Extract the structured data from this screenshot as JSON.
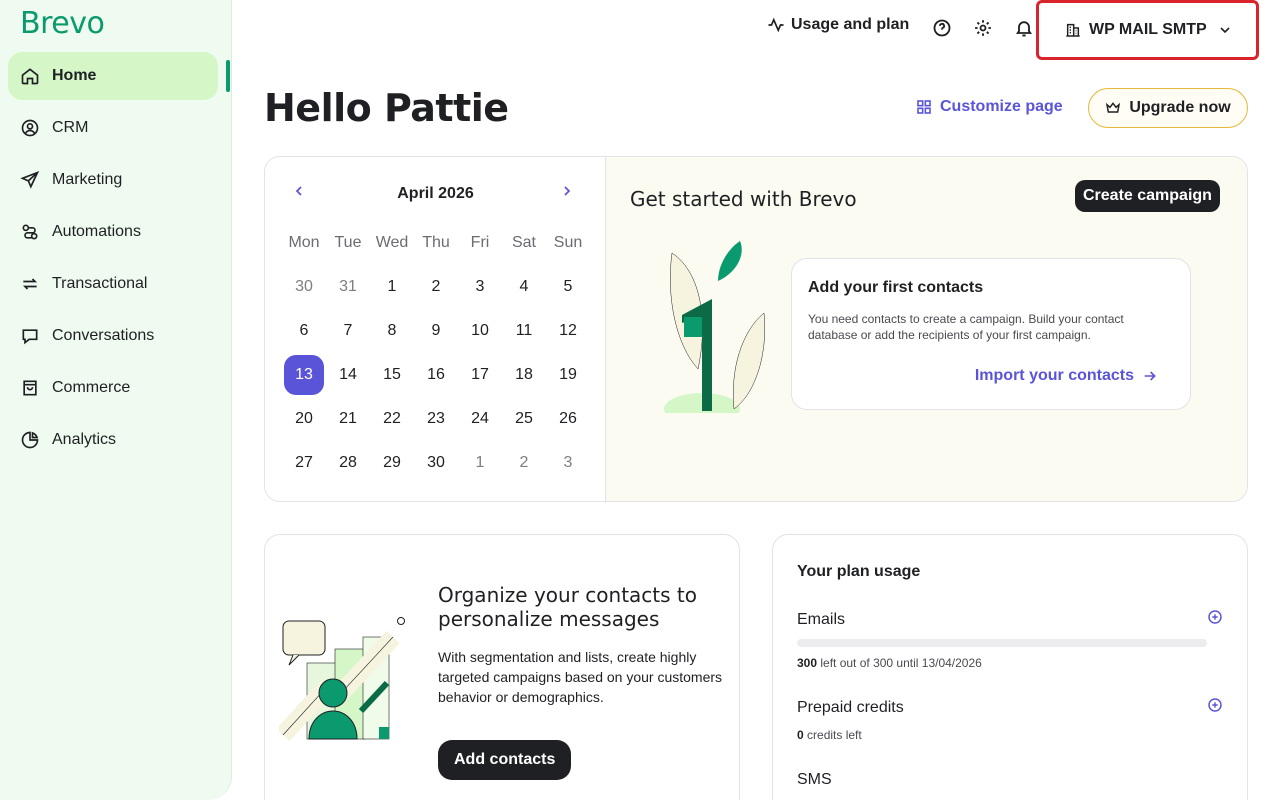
{
  "brand": {
    "logo": "Brevo"
  },
  "sidebar": {
    "items": [
      {
        "label": "Home",
        "icon": "home-icon",
        "active": true
      },
      {
        "label": "CRM",
        "icon": "user-circle-icon"
      },
      {
        "label": "Marketing",
        "icon": "paper-plane-icon"
      },
      {
        "label": "Automations",
        "icon": "automation-icon"
      },
      {
        "label": "Transactional",
        "icon": "arrows-exchange-icon"
      },
      {
        "label": "Conversations",
        "icon": "chat-bubble-icon"
      },
      {
        "label": "Commerce",
        "icon": "shopping-bag-icon"
      },
      {
        "label": "Analytics",
        "icon": "pie-chart-icon"
      }
    ]
  },
  "topbar": {
    "usage_label": "Usage and plan",
    "account_name": "WP MAIL SMTP"
  },
  "header": {
    "greeting": "Hello Pattie",
    "customize_label": "Customize page",
    "upgrade_label": "Upgrade now"
  },
  "calendar": {
    "month_label": "April 2026",
    "weekdays": [
      "Mon",
      "Tue",
      "Wed",
      "Thu",
      "Fri",
      "Sat",
      "Sun"
    ],
    "days": [
      [
        "30",
        "31",
        "1",
        "2",
        "3",
        "4",
        "5"
      ],
      [
        "6",
        "7",
        "8",
        "9",
        "10",
        "11",
        "12"
      ],
      [
        "13",
        "14",
        "15",
        "16",
        "17",
        "18",
        "19"
      ],
      [
        "20",
        "21",
        "22",
        "23",
        "24",
        "25",
        "26"
      ],
      [
        "27",
        "28",
        "29",
        "30",
        "1",
        "2",
        "3"
      ]
    ],
    "today": "13"
  },
  "get_started": {
    "title": "Get started with Brevo",
    "create_label": "Create campaign",
    "card_title": "Add your first contacts",
    "card_text": "You need contacts to create a campaign. Build your contact database or add the recipients of your first campaign.",
    "card_link": "Import your contacts"
  },
  "organize": {
    "title": "Organize your contacts to personalize messages",
    "text": "With segmentation and lists, create highly targeted campaigns based on your customers behavior or demographics.",
    "button_label": "Add contacts"
  },
  "plan": {
    "title": "Your plan usage",
    "emails_label": "Emails",
    "emails_left": "300",
    "emails_note": " left out of 300 until 13/04/2026",
    "emails_used_fraction": 0,
    "credits_label": "Prepaid credits",
    "credits_left": "0",
    "credits_note": " credits left",
    "sms_label": "SMS"
  },
  "colors": {
    "brand_green": "#0b996e",
    "accent_purple": "#5a55d8",
    "highlight_red": "#d9242b",
    "sidebar_bg": "#effaf0"
  }
}
